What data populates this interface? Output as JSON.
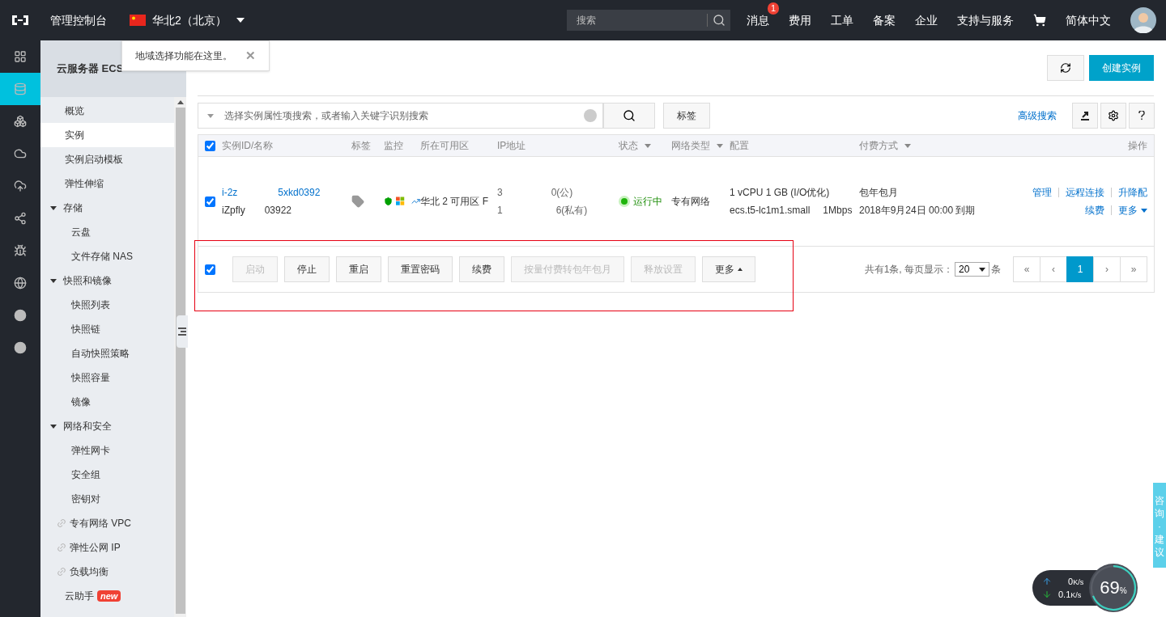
{
  "topbar": {
    "title": "管理控制台",
    "region": "华北2（北京）",
    "search": {
      "placeholder": "搜索"
    },
    "nav": [
      {
        "label": "消息",
        "badge": "1"
      },
      {
        "label": "费用"
      },
      {
        "label": "工单"
      },
      {
        "label": "备案"
      },
      {
        "label": "企业"
      },
      {
        "label": "支持与服务"
      }
    ],
    "language": "简体中文"
  },
  "tooltip": {
    "text": "地域选择功能在这里。",
    "close": "✕"
  },
  "rail": [
    {
      "selected": false
    },
    {
      "selected": true
    },
    {
      "selected": false
    },
    {
      "selected": false
    },
    {
      "selected": false
    },
    {
      "selected": false
    },
    {
      "selected": false
    },
    {
      "selected": false
    },
    {
      "selected": false
    },
    {
      "selected": false
    }
  ],
  "sidebar": {
    "title": "云服务器 ECS",
    "items": [
      {
        "kind": "item",
        "label": "概览",
        "selected": false
      },
      {
        "kind": "item",
        "label": "实例",
        "selected": true
      },
      {
        "kind": "item",
        "label": "实例启动模板",
        "selected": false
      },
      {
        "kind": "item",
        "label": "弹性伸缩",
        "selected": false
      },
      {
        "kind": "group",
        "label": "存储",
        "expanded": true,
        "children": [
          {
            "label": "云盘",
            "selected": false
          },
          {
            "label": "文件存储 NAS",
            "selected": false
          }
        ]
      },
      {
        "kind": "group",
        "label": "快照和镜像",
        "expanded": true,
        "children": [
          {
            "label": "快照列表",
            "selected": false
          },
          {
            "label": "快照链",
            "selected": false
          },
          {
            "label": "自动快照策略",
            "selected": false
          },
          {
            "label": "快照容量",
            "selected": false
          },
          {
            "label": "镜像",
            "selected": false
          }
        ]
      },
      {
        "kind": "group",
        "label": "网络和安全",
        "expanded": true,
        "children": [
          {
            "label": "弹性网卡",
            "selected": false
          },
          {
            "label": "安全组",
            "selected": false
          },
          {
            "label": "密钥对",
            "selected": false
          }
        ]
      },
      {
        "kind": "link",
        "label": "专有网络 VPC",
        "selected": false
      },
      {
        "kind": "link",
        "label": "弹性公网 IP",
        "selected": false
      },
      {
        "kind": "link",
        "label": "负载均衡",
        "selected": false
      },
      {
        "kind": "item",
        "label": "云助手",
        "badge": "new",
        "selected": false
      }
    ]
  },
  "main": {
    "create_button": "创建实例",
    "filter": {
      "placeholder": "选择实例属性项搜索，或者输入关键字识别搜索",
      "tag_button": "标签",
      "advanced": "高级搜索"
    },
    "table": {
      "all_checked": true,
      "columns": [
        {
          "label": "实例ID/名称",
          "sortable": false
        },
        {
          "label": "标签",
          "sortable": false
        },
        {
          "label": "监控",
          "sortable": false
        },
        {
          "label": "所在可用区",
          "sortable": false
        },
        {
          "label": "IP地址",
          "sortable": false
        },
        {
          "label": "状态",
          "sortable": true
        },
        {
          "label": "网络类型",
          "sortable": true
        },
        {
          "label": "配置",
          "sortable": false
        },
        {
          "label": "付费方式",
          "sortable": true
        },
        {
          "label": "操作",
          "sortable": false
        }
      ],
      "rows": [
        {
          "checked": true,
          "id_parts": [
            "i-2z",
            "5xkd0392"
          ],
          "name_parts": [
            "iZpfly",
            "03922"
          ],
          "zone": "华北 2 可用区 F",
          "ip_public": [
            "3",
            "0(公)"
          ],
          "ip_private": [
            "1",
            "6(私有)"
          ],
          "status": "运行中",
          "running": true,
          "network": "专有网络",
          "config": [
            "1 vCPU 1 GB (I/O优化)",
            "ecs.t5-lc1m1.small",
            "1Mbps"
          ],
          "billing": [
            "包年包月",
            "2018年9月24日 00:00 到期"
          ],
          "actions": [
            [
              "管理",
              "远程连接",
              "升降配"
            ],
            [
              "续费",
              "更多"
            ]
          ]
        }
      ]
    },
    "bulk": {
      "checked": true,
      "buttons": [
        {
          "label": "启动",
          "disabled": true
        },
        {
          "label": "停止",
          "disabled": false
        },
        {
          "label": "重启",
          "disabled": false
        },
        {
          "label": "重置密码",
          "disabled": false
        },
        {
          "label": "续费",
          "disabled": false
        },
        {
          "label": "按量付费转包年包月",
          "disabled": true
        },
        {
          "label": "释放设置",
          "disabled": true
        },
        {
          "label": "更多",
          "disabled": false
        }
      ]
    },
    "pagination": {
      "summary": "共有1条, 每页显示：",
      "page_size": "20",
      "unit": "条",
      "pages": [
        {
          "label": "«",
          "selected": false
        },
        {
          "label": "‹",
          "selected": false
        },
        {
          "label": "1",
          "selected": true
        },
        {
          "label": "›",
          "selected": false
        },
        {
          "label": "»",
          "selected": false
        }
      ]
    }
  },
  "consult": {
    "chars": [
      "咨",
      "询",
      "·",
      "建",
      "议"
    ]
  },
  "speed_widget": {
    "up": "0",
    "down": "0.1",
    "up_unit": "K/s",
    "down_unit": "K/s",
    "percent": "69",
    "percent_sign": "%"
  }
}
